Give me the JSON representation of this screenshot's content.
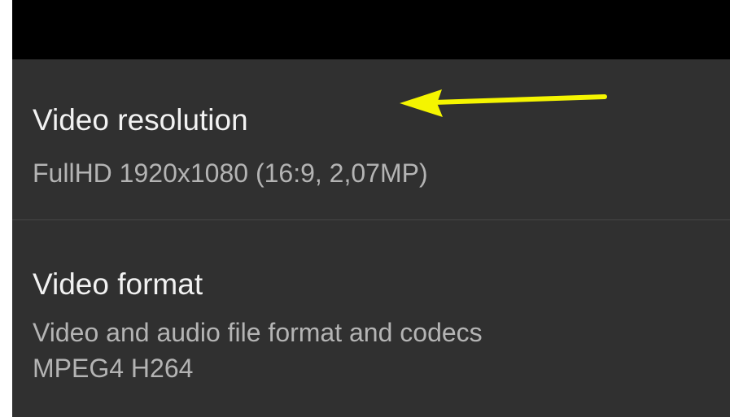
{
  "settings": {
    "items": [
      {
        "title": "Video resolution",
        "summary": "FullHD 1920x1080 (16:9, 2,07MP)"
      },
      {
        "title": "Video format",
        "summary_line1": "Video and audio file format and codecs",
        "summary_line2": "MPEG4 H264"
      }
    ]
  },
  "colors": {
    "background": "#303030",
    "status_bar": "#000000",
    "title_text": "#f2f2f2",
    "summary_text": "#b4b4b4",
    "divider": "#474747",
    "annotation_arrow": "#f5f500"
  },
  "annotation": {
    "icon": "yellow-arrow-left-icon"
  }
}
